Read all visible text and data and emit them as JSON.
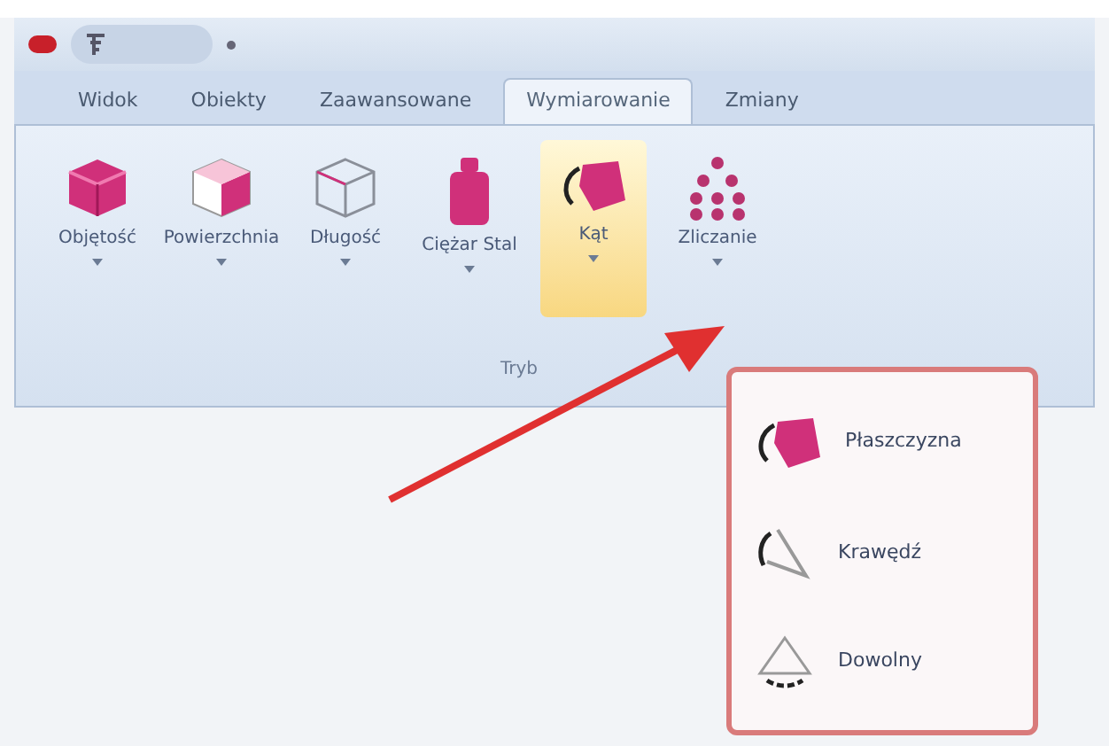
{
  "tabs": [
    {
      "label": "Widok",
      "selected": false
    },
    {
      "label": "Obiekty",
      "selected": false
    },
    {
      "label": "Zaawansowane",
      "selected": false
    },
    {
      "label": "Wymiarowanie",
      "selected": true
    },
    {
      "label": "Zmiany",
      "selected": false
    }
  ],
  "ribbon": {
    "buttons": [
      {
        "label": "Objętość",
        "kind": "solid-cube",
        "highlighted": false
      },
      {
        "label": "Powierzchnia",
        "kind": "face-cube",
        "highlighted": false
      },
      {
        "label": "Długość",
        "kind": "wire-cube",
        "highlighted": false
      },
      {
        "label": "Ciężar Stal",
        "kind": "weight",
        "highlighted": false
      },
      {
        "label": "Kąt",
        "kind": "angle",
        "highlighted": true
      },
      {
        "label": "Zliczanie",
        "kind": "dots",
        "highlighted": false
      }
    ],
    "group_label": "Tryb"
  },
  "menu": {
    "items": [
      {
        "label": "Płaszczyzna",
        "kind": "angle"
      },
      {
        "label": "Krawędź",
        "kind": "edge"
      },
      {
        "label": "Dowolny",
        "kind": "free"
      }
    ]
  }
}
